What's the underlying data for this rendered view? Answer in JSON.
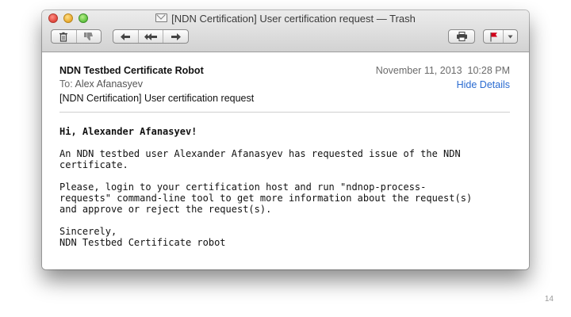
{
  "window": {
    "title": "[NDN Certification] User certification request — Trash"
  },
  "toolbar": {
    "buttons": [
      {
        "name": "delete",
        "icon": "trash-icon"
      },
      {
        "name": "junk",
        "icon": "thumbs-down-icon"
      },
      {
        "name": "reply",
        "icon": "reply-arrow-icon"
      },
      {
        "name": "reply-all",
        "icon": "reply-all-arrow-icon"
      },
      {
        "name": "forward",
        "icon": "forward-arrow-icon"
      },
      {
        "name": "print",
        "icon": "printer-icon"
      },
      {
        "name": "flag",
        "icon": "red-flag-icon"
      }
    ]
  },
  "header": {
    "sender": "NDN Testbed Certificate Robot",
    "to_label": "To:",
    "to_name": "Alex Afanasyev",
    "subject": "[NDN Certification] User certification request",
    "date": "November 11, 2013  10:28 PM",
    "hide_details": "Hide Details"
  },
  "body": {
    "greeting": "Hi, Alexander Afanasyev!",
    "paragraph1": "An NDN testbed user Alexander Afanasyev has requested issue of the NDN\ncertificate.",
    "paragraph2": "Please, login to your certification host and run \"ndnop-process-\nrequests\" command-line tool to get more information about the request(s)\nand approve or reject the request(s).",
    "closing": "Sincerely,\nNDN Testbed Certificate robot"
  },
  "page_number": "14",
  "colors": {
    "link": "#2a6bd1",
    "flag": "#d0021b"
  }
}
